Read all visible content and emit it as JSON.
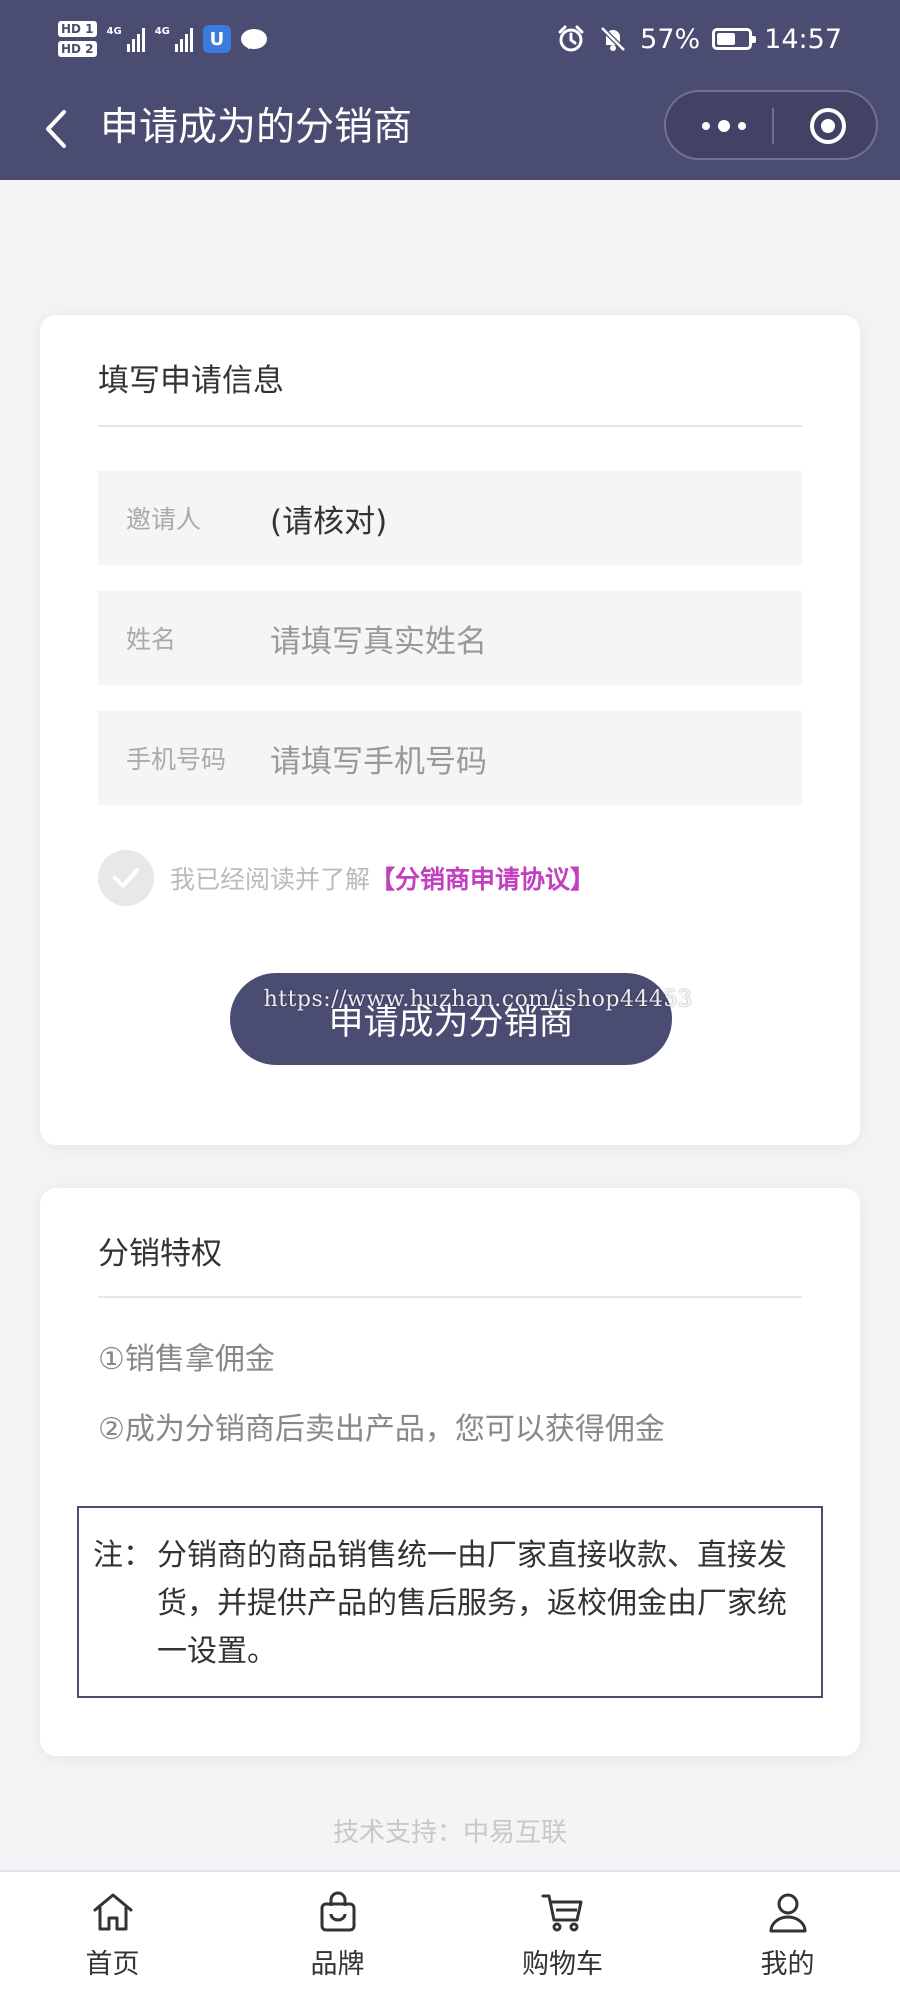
{
  "status_bar": {
    "sim1": "HD 1",
    "sim2": "HD 2",
    "net1": "4G",
    "net2": "4G",
    "app_badge": "U",
    "battery_percent": "57%",
    "time": "14:57"
  },
  "nav": {
    "title": "申请成为的分销商"
  },
  "form_card": {
    "title": "填写申请信息",
    "fields": [
      {
        "label": "邀请人",
        "value": "(请核对)",
        "placeholder": ""
      },
      {
        "label": "姓名",
        "value": "",
        "placeholder": "请填写真实姓名"
      },
      {
        "label": "手机号码",
        "value": "",
        "placeholder": "请填写手机号码"
      }
    ],
    "agree_text": "我已经阅读并了解",
    "agree_link": "【分销商申请协议】",
    "submit_label": "申请成为分销商",
    "watermark": "https://www.huzhan.com/ishop44453"
  },
  "privilege_card": {
    "title": "分销特权",
    "items": [
      "①销售拿佣金",
      "②成为分销商后卖出产品，您可以获得佣金"
    ],
    "note_label": "注：",
    "note_text": "分销商的商品销售统一由厂家直接收款、直接发货，并提供产品的售后服务，返校佣金由厂家统一设置。"
  },
  "footer": {
    "support": "技术支持：中易互联"
  },
  "tabbar": {
    "items": [
      {
        "label": "首页",
        "icon": "home-icon"
      },
      {
        "label": "品牌",
        "icon": "bag-icon"
      },
      {
        "label": "购物车",
        "icon": "cart-icon"
      },
      {
        "label": "我的",
        "icon": "user-icon"
      }
    ]
  },
  "colors": {
    "primary": "#4b4c72",
    "link": "#c43fc0",
    "background": "#f4f4f6"
  }
}
